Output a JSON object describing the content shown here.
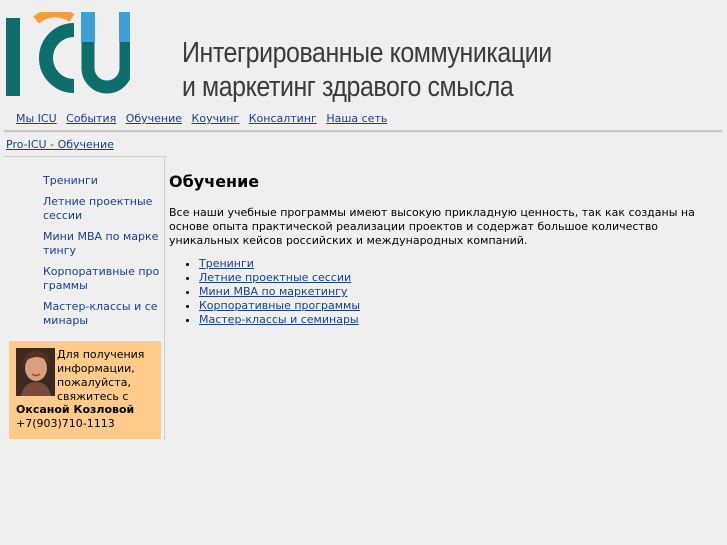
{
  "header": {
    "logo_text": "ICU",
    "tagline_line1": "Интегрированные коммуникации",
    "tagline_line2": "и маркетинг здравого смысла"
  },
  "nav": {
    "items": [
      "Мы ICU",
      "События",
      "Обучение",
      "Коучинг",
      "Консалтинг",
      "Наша сеть"
    ]
  },
  "breadcrumb": "Pro-ICU - Обучение",
  "sidebar": {
    "items": [
      "Тренинги",
      "Летние проектные сессии",
      "Мини MBA по маркетингу",
      "Корпоративные программы",
      "Мастер-классы и семинары"
    ],
    "contact": {
      "text": "Для получения информации, пожалуйста, свяжитесь с",
      "name": "Оксаной Козловой",
      "phone": "+7(903)710-1113"
    }
  },
  "main": {
    "title": "Обучение",
    "intro": "Все наши учебные программы имеют высокую прикладную ценность, так как созданы на основе опыта практической реализации проектов и содержат большое количество уникальных кейсов российских и международных компаний.",
    "links": [
      "Тренинги",
      "Летние проектные сессии",
      "Мини MBA по маркетингу",
      "Корпоративные программы",
      "Мастер-классы и семинары"
    ]
  },
  "colors": {
    "background": "#efefef",
    "link": "#1a3f8f",
    "logo_teal": "#0e6e6a",
    "logo_orange": "#f2a03d",
    "logo_blue": "#3d9fd6",
    "contact_bg": "#ffcb8a"
  }
}
